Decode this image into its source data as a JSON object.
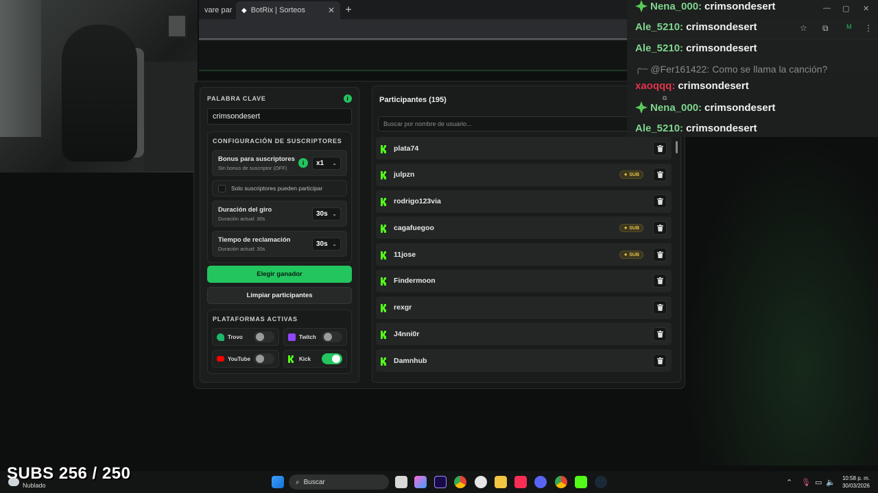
{
  "browser": {
    "tabs": [
      {
        "label": "vare par",
        "active": false
      },
      {
        "label": "BotRix | Sorteos",
        "active": true
      }
    ],
    "new_tab": "+"
  },
  "left_panel": {
    "keyword_label": "PALABRA CLAVE",
    "keyword_value": "crimsondesert",
    "subs_config_label": "CONFIGURACIÓN DE SUSCRIPTORES",
    "subs_bonus": {
      "title": "Bonus para suscriptores",
      "desc": "Sin bonus de suscriptor (OFF)",
      "value": "x1"
    },
    "subs_only": {
      "label": "Solo suscriptores pueden participar",
      "checked": false
    },
    "spin_duration": {
      "title": "Duración del giro",
      "desc": "Duración actual: 30s",
      "value": "30s"
    },
    "claim_time": {
      "title": "Tiempo de reclamación",
      "desc": "Duración actual: 30s",
      "value": "30s"
    },
    "pick_winner_label": "Elegir ganador",
    "clear_label": "Limpiar participantes",
    "platforms_label": "PLATAFORMAS ACTIVAS",
    "platforms": [
      {
        "name": "Trovo",
        "enabled": false,
        "color": "#1fb66c"
      },
      {
        "name": "Twitch",
        "enabled": false,
        "color": "#9146ff"
      },
      {
        "name": "YouTube",
        "enabled": false,
        "color": "#ff0000"
      },
      {
        "name": "Kick",
        "enabled": true,
        "color": "#53fc18"
      }
    ]
  },
  "participants": {
    "title": "Participantes (195)",
    "search_placeholder": "Buscar por nombre de usuario...",
    "sub_badge": "SUB",
    "rows": [
      {
        "name": "plata74",
        "sub": false
      },
      {
        "name": "julpzn",
        "sub": true
      },
      {
        "name": "rodrigo123via",
        "sub": false
      },
      {
        "name": "cagafuegoo",
        "sub": true
      },
      {
        "name": "11jose",
        "sub": true
      },
      {
        "name": "Findermoon",
        "sub": false
      },
      {
        "name": "rexgr",
        "sub": false
      },
      {
        "name": "J4nni0r",
        "sub": false
      },
      {
        "name": "Damnhub",
        "sub": false
      }
    ]
  },
  "chat": [
    {
      "user": "Nena_000:",
      "msg": "crimsondesert",
      "color": "#7ed68f",
      "badge": true
    },
    {
      "user": "Ale_5210:",
      "msg": "crimsondesert",
      "color": "#7ed68f",
      "badge": false
    },
    {
      "user": "Ale_5210:",
      "msg": "crimsondesert",
      "color": "#7ed68f",
      "badge": false
    },
    {
      "user": "@Fer161422:",
      "msg": "Como se llama la canción?",
      "color": "#8a8a8a",
      "reply": true
    },
    {
      "user": "xaoqqq:",
      "msg": "crimsondesert",
      "color": "#e0344a",
      "badge": false
    },
    {
      "user": "Nena_000:",
      "msg": "crimsondesert",
      "color": "#7ed68f",
      "badge": true
    },
    {
      "user": "Ale_5210:",
      "msg": "crimsondesert",
      "color": "#7ed68f",
      "badge": false
    }
  ],
  "overlay": {
    "subs_counter": "SUBS 256 / 250",
    "weather": "Nublado"
  },
  "taskbar": {
    "search": "Buscar",
    "time": "10:58 p. m.",
    "date": "30/03/2026"
  },
  "colors": {
    "accent": "#22c55e",
    "kick": "#53fc18",
    "sub_badge": "#e8c547"
  }
}
